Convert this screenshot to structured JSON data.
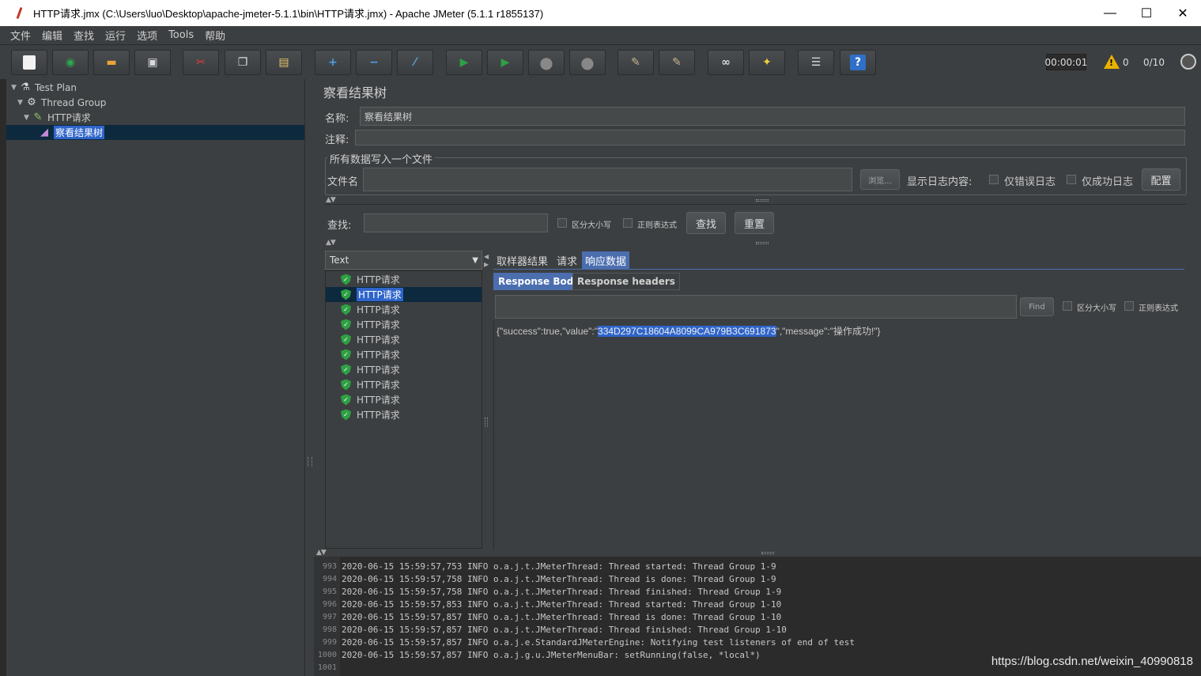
{
  "window": {
    "title": "HTTP请求.jmx (C:\\Users\\luo\\Desktop\\apache-jmeter-5.1.1\\bin\\HTTP请求.jmx) - Apache JMeter (5.1.1 r1855137)",
    "minimize": "—",
    "maximize": "☐",
    "close": "✕"
  },
  "menu": [
    "文件",
    "编辑",
    "查找",
    "运行",
    "选项",
    "Tools",
    "帮助"
  ],
  "toolbar": {
    "buttons": [
      {
        "name": "new-icon",
        "glyph": "",
        "color": "#f2f2f2"
      },
      {
        "name": "templates-icon",
        "glyph": "◉",
        "color": "#2fa84f"
      },
      {
        "name": "open-icon",
        "glyph": "▬",
        "color": "#e8a43a"
      },
      {
        "name": "save-icon",
        "glyph": "▣",
        "color": "#d9d9d9"
      },
      {
        "name": "cut-icon",
        "glyph": "✂",
        "color": "#e03c3c"
      },
      {
        "name": "copy-icon",
        "glyph": "❐",
        "color": "#dddddd"
      },
      {
        "name": "paste-icon",
        "glyph": "▤",
        "color": "#e6c36a"
      },
      {
        "name": "expand-icon",
        "glyph": "+",
        "color": "#4b9fe8"
      },
      {
        "name": "collapse-icon",
        "glyph": "−",
        "color": "#4b9fe8"
      },
      {
        "name": "toggle-icon",
        "glyph": "⁄",
        "color": "#58a8d8"
      },
      {
        "name": "start-icon",
        "glyph": "▶",
        "color": "#2ea043"
      },
      {
        "name": "start-no-pause-icon",
        "glyph": "▶",
        "color": "#2ea043"
      },
      {
        "name": "stop-icon",
        "glyph": "●",
        "color": "#888888"
      },
      {
        "name": "shutdown-icon",
        "glyph": "●",
        "color": "#888888"
      },
      {
        "name": "clear-icon",
        "glyph": "✎",
        "color": "#c8b48a"
      },
      {
        "name": "clear-all-icon",
        "glyph": "✎",
        "color": "#c8b48a"
      },
      {
        "name": "search-icon",
        "glyph": "∞",
        "color": "#dddddd"
      },
      {
        "name": "reset-search-icon",
        "glyph": "✦",
        "color": "#f0d040"
      },
      {
        "name": "function-helper-icon",
        "glyph": "☰",
        "color": "#dddddd"
      },
      {
        "name": "help-icon",
        "glyph": "?",
        "color": "#4b9fe8"
      }
    ],
    "timer": "00:00:01",
    "warn_count": "0",
    "threads": "0/10"
  },
  "tree": [
    {
      "label": "Test Plan",
      "icon": "flask-icon"
    },
    {
      "label": "Thread Group",
      "icon": "gear-icon"
    },
    {
      "label": "HTTP请求",
      "icon": "pipette-icon"
    },
    {
      "label": "察看结果树",
      "icon": "chart-icon",
      "selected": true
    }
  ],
  "panel": {
    "title": "察看结果树",
    "name_label": "名称:",
    "name_value": "察看结果树",
    "comment_label": "注释:",
    "comment_value": "",
    "file_group_title": "所有数据写入一个文件",
    "filename_label": "文件名",
    "filename_value": "",
    "browse_label": "浏览...",
    "log_content_label": "显示日志内容:",
    "errors_only_label": "仅错误日志",
    "success_only_label": "仅成功日志",
    "configure_label": "配置",
    "search_label": "查找:",
    "search_value": "",
    "case_sensitive_label": "区分大小写",
    "regex_label": "正则表达式",
    "find_button": "查找",
    "reset_button": "重置"
  },
  "renderer": {
    "selected": "Text"
  },
  "results": {
    "items": [
      "HTTP请求",
      "HTTP请求",
      "HTTP请求",
      "HTTP请求",
      "HTTP请求",
      "HTTP请求",
      "HTTP请求",
      "HTTP请求",
      "HTTP请求",
      "HTTP请求"
    ],
    "selected_index": 1
  },
  "tabs": {
    "main": [
      "取样器结果",
      "请求",
      "响应数据"
    ],
    "active_main": "响应数据",
    "sub": [
      "Response Body",
      "Response headers"
    ],
    "active_sub": "Response Body"
  },
  "response": {
    "search_value": "",
    "find_label": "Find",
    "case_label": "区分大小写",
    "regex_label": "正则表达式",
    "body_prefix": "{\"success\":true,\"value\":\"",
    "body_highlight": "334D297C18604A8099CA979B3C691873",
    "body_suffix": "\",\"message\":\"操作成功!\"}"
  },
  "log": {
    "lines": [
      {
        "num": "993",
        "text": "2020-06-15 15:59:57,753 INFO o.a.j.t.JMeterThread: Thread started: Thread Group 1-9"
      },
      {
        "num": "994",
        "text": "2020-06-15 15:59:57,758 INFO o.a.j.t.JMeterThread: Thread is done: Thread Group 1-9"
      },
      {
        "num": "995",
        "text": "2020-06-15 15:59:57,758 INFO o.a.j.t.JMeterThread: Thread finished: Thread Group 1-9"
      },
      {
        "num": "996",
        "text": "2020-06-15 15:59:57,853 INFO o.a.j.t.JMeterThread: Thread started: Thread Group 1-10"
      },
      {
        "num": "997",
        "text": "2020-06-15 15:59:57,857 INFO o.a.j.t.JMeterThread: Thread is done: Thread Group 1-10"
      },
      {
        "num": "998",
        "text": "2020-06-15 15:59:57,857 INFO o.a.j.t.JMeterThread: Thread finished: Thread Group 1-10"
      },
      {
        "num": "999",
        "text": "2020-06-15 15:59:57,857 INFO o.a.j.e.StandardJMeterEngine: Notifying test listeners of end of test"
      },
      {
        "num": "1000",
        "text": "2020-06-15 15:59:57,857 INFO o.a.j.g.u.JMeterMenuBar: setRunning(false, *local*)"
      },
      {
        "num": "1001",
        "text": ""
      }
    ]
  },
  "watermark": "https://blog.csdn.net/weixin_40990818"
}
